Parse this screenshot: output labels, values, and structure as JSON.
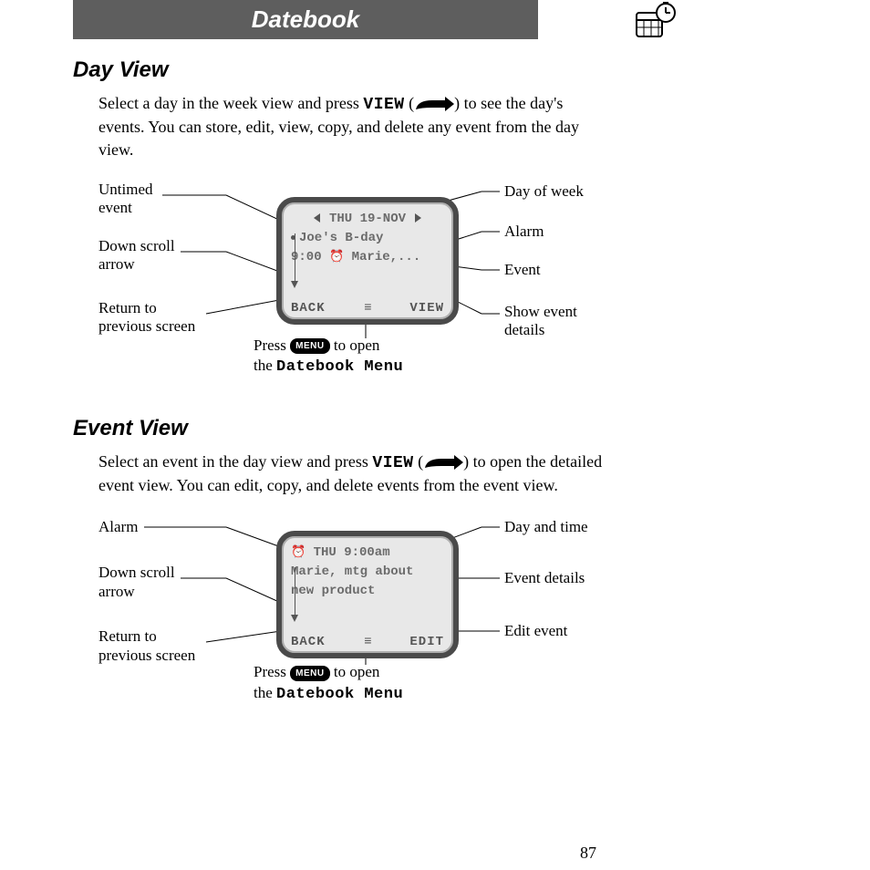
{
  "header": {
    "title": "Datebook",
    "icon": "calendar-clock-icon"
  },
  "page_number": "87",
  "sections": {
    "day": {
      "heading": "Day View",
      "body_pre": "Select a day in the week view and press ",
      "body_key": "VIEW",
      "body_post": " (",
      "body_after_btn": ") to see the day's events. You can store, edit, view, copy, and delete any event from the day view.",
      "screen": {
        "date_line": "THU 19-NOV",
        "event1": "Joe's B-day",
        "event2_time": "9:00",
        "event2_text": "Marie,...",
        "soft_left": "BACK",
        "soft_right": "VIEW"
      },
      "callouts": {
        "untimed": "Untimed\nevent",
        "downscroll": "Down scroll\narrow",
        "return": "Return to\nprevious screen",
        "dayofweek": "Day of week",
        "alarm": "Alarm",
        "event": "Event",
        "showdetails": "Show event\ndetails"
      },
      "caption_pre": "Press ",
      "caption_menu": "MENU",
      "caption_mid": " to open\nthe ",
      "caption_menu2": "Datebook Menu"
    },
    "evt": {
      "heading": "Event View",
      "body_pre": "Select an event in the day view and press ",
      "body_key": "VIEW",
      "body_post": " (",
      "body_after_btn": ") to open the detailed event view. You can edit, copy, and delete events from the event view.",
      "screen": {
        "date_line": "THU 9:00am",
        "line2": "Marie, mtg about",
        "line3": "new product",
        "soft_left": "BACK",
        "soft_right": "EDIT"
      },
      "callouts": {
        "alarm": "Alarm",
        "downscroll": "Down scroll\narrow",
        "return": "Return to\nprevious screen",
        "daytime": "Day and time",
        "details": "Event details",
        "edit": "Edit event"
      },
      "caption_pre": "Press ",
      "caption_menu": "MENU",
      "caption_mid": " to open\nthe ",
      "caption_menu2": "Datebook Menu"
    }
  }
}
